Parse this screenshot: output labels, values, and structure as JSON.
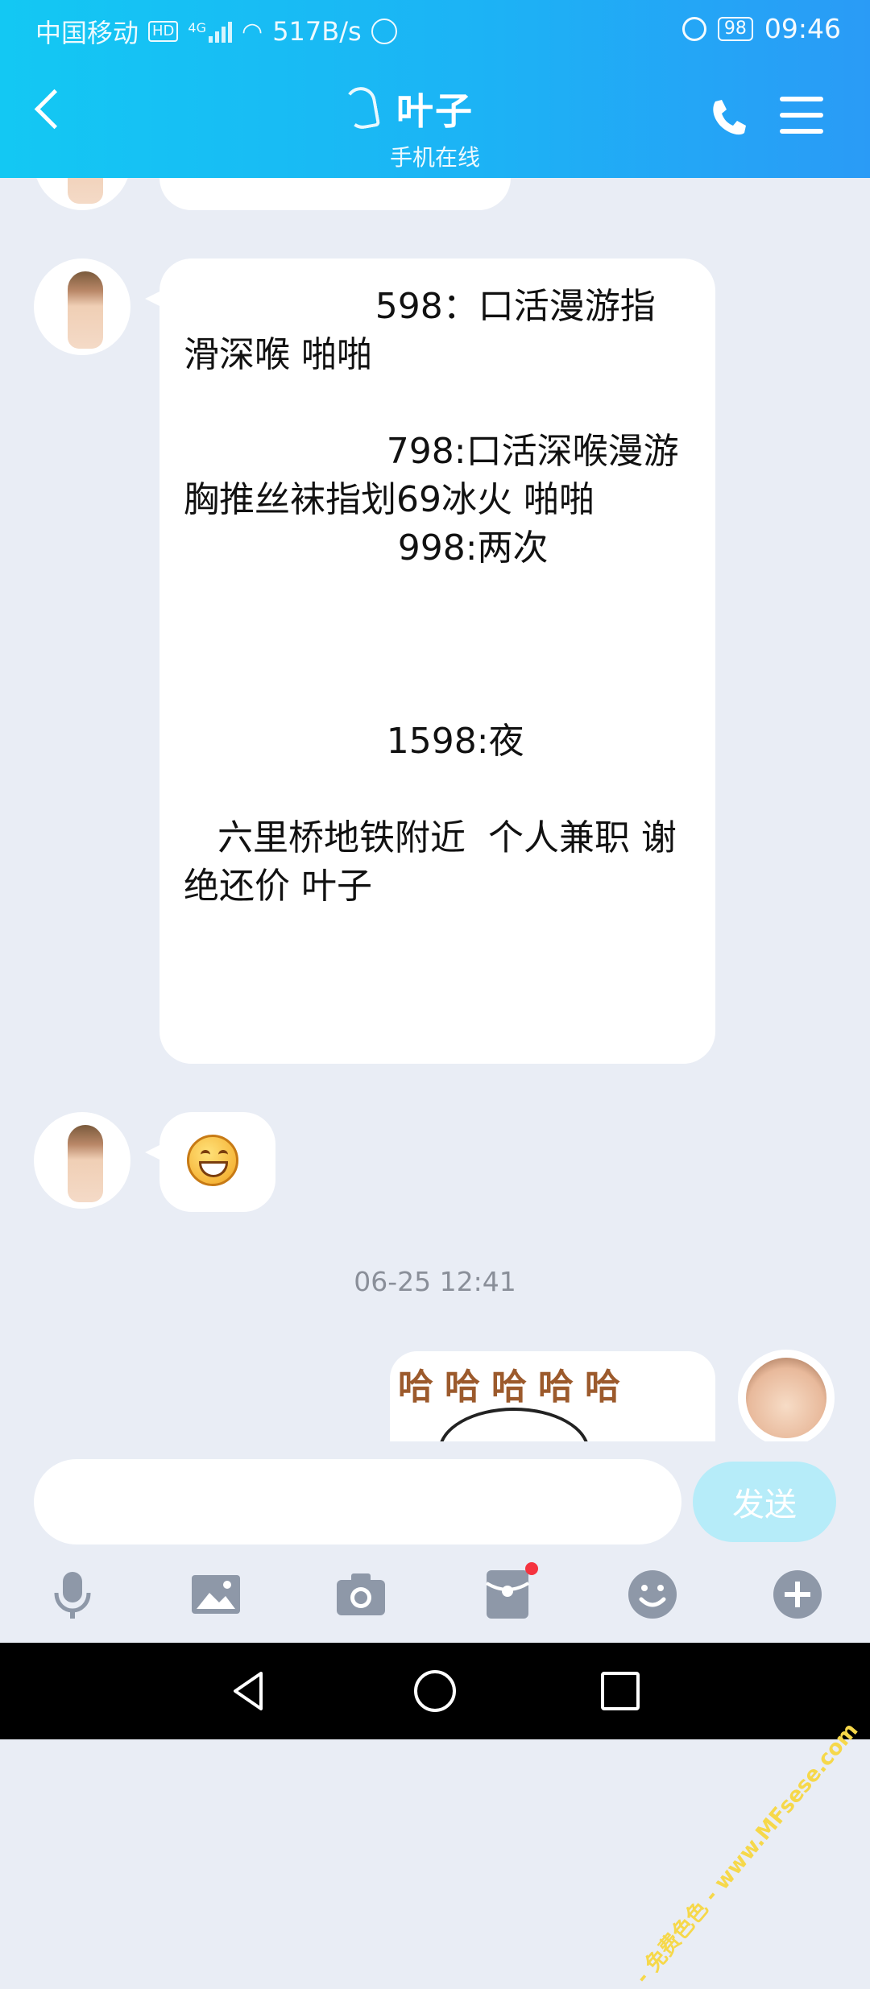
{
  "status_bar": {
    "carrier": "中国移动",
    "hd": "HD",
    "network": "4G",
    "speed": "517B/s",
    "battery": "98",
    "time": "09:46"
  },
  "header": {
    "title": "叶子",
    "subtitle": "手机在线"
  },
  "messages": [
    {
      "text": "                 598：口活漫游指滑深喉 啪啪\n\n                  798:口活深喉漫游胸推丝袜指划69冰火 啪啪\n                   998:两次\n\n\n\n                  1598:夜\n\n   六里桥地铁附近  个人兼职 谢绝还价 叶子"
    }
  ],
  "timestamp": "06-25 12:41",
  "sticker_text": "哈哈哈哈哈",
  "input": {
    "placeholder": "",
    "send_label": "发送"
  },
  "toolbar": [
    "voice-icon",
    "image-icon",
    "camera-icon",
    "red-packet-icon",
    "emoji-icon",
    "plus-icon"
  ],
  "watermark": "- 免费色色 - www.MFsese.com",
  "colors": {
    "header_start": "#13c8f3",
    "header_end": "#2a9bf6",
    "chat_bg": "#e9edf5",
    "send_button": "#b6ecf9",
    "unread_dot": "#f5333f"
  }
}
